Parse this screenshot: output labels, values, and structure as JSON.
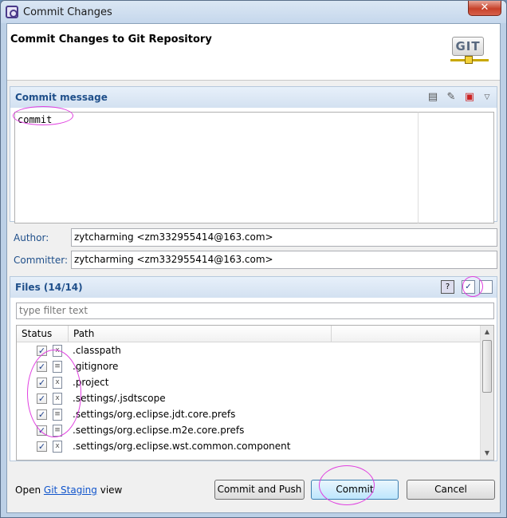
{
  "window": {
    "title": "Commit Changes",
    "close_glyph": "✕"
  },
  "header": {
    "heading": "Commit Changes to Git Repository",
    "logo_text": "GIT"
  },
  "commit_message": {
    "section_title": "Commit message",
    "value": "commit"
  },
  "author": {
    "label": "Author:",
    "value": "zytcharming <zm332955414@163.com>"
  },
  "committer": {
    "label": "Committer:",
    "value": "zytcharming <zm332955414@163.com>"
  },
  "files": {
    "section_title": "Files (14/14)",
    "filter_placeholder": "type filter text",
    "columns": {
      "status": "Status",
      "path": "Path"
    },
    "rows": [
      {
        "checked": "✓",
        "path": ".classpath"
      },
      {
        "checked": "✓",
        "path": ".gitignore"
      },
      {
        "checked": "✓",
        "path": ".project"
      },
      {
        "checked": "✓",
        "path": ".settings/.jsdtscope"
      },
      {
        "checked": "✓",
        "path": ".settings/org.eclipse.jdt.core.prefs"
      },
      {
        "checked": "✓",
        "path": ".settings/org.eclipse.m2e.core.prefs"
      },
      {
        "checked": "✓",
        "path": ".settings/org.eclipse.wst.common.component"
      }
    ]
  },
  "footer": {
    "open_text": "Open",
    "link_text": "Git Staging",
    "view_text": "view"
  },
  "buttons": {
    "commit_and_push": "Commit and Push",
    "commit": "Commit",
    "cancel": "Cancel"
  },
  "annotation_color": "#e040e0"
}
